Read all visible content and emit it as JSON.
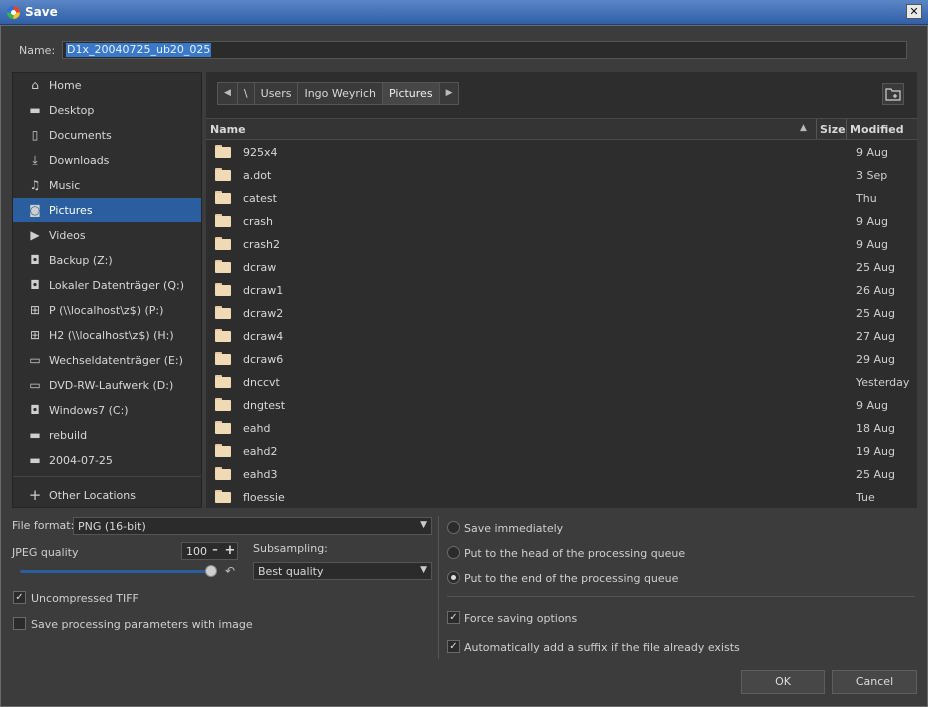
{
  "window": {
    "title": "Save",
    "close_glyph": "✕"
  },
  "name_field": {
    "label": "Name:",
    "value": "D1x_20040725_ub20_025"
  },
  "sidebar": {
    "items": [
      {
        "label": "Home",
        "icon": "home-icon",
        "glyph": "⌂",
        "active": false
      },
      {
        "label": "Desktop",
        "icon": "folder-icon",
        "glyph": "▬",
        "active": false
      },
      {
        "label": "Documents",
        "icon": "document-icon",
        "glyph": "▯",
        "active": false
      },
      {
        "label": "Downloads",
        "icon": "download-icon",
        "glyph": "⤓",
        "active": false
      },
      {
        "label": "Music",
        "icon": "music-icon",
        "glyph": "♫",
        "active": false
      },
      {
        "label": "Pictures",
        "icon": "camera-icon",
        "glyph": "◙",
        "active": true
      },
      {
        "label": "Videos",
        "icon": "video-icon",
        "glyph": "▶",
        "active": false
      },
      {
        "label": "Backup (Z:)",
        "icon": "drive-icon",
        "glyph": "◘",
        "active": false
      },
      {
        "label": "Lokaler Datenträger (Q:)",
        "icon": "drive-icon",
        "glyph": "◘",
        "active": false
      },
      {
        "label": "P (\\\\localhost\\z$) (P:)",
        "icon": "network-drive-icon",
        "glyph": "⊞",
        "active": false
      },
      {
        "label": "H2 (\\\\localhost\\z$) (H:)",
        "icon": "network-drive-icon",
        "glyph": "⊞",
        "active": false
      },
      {
        "label": "Wechseldatenträger (E:)",
        "icon": "removable-drive-icon",
        "glyph": "▭",
        "active": false
      },
      {
        "label": "DVD-RW-Laufwerk (D:)",
        "icon": "optical-drive-icon",
        "glyph": "▭",
        "active": false
      },
      {
        "label": "Windows7 (C:)",
        "icon": "drive-icon",
        "glyph": "◘",
        "active": false
      },
      {
        "label": "rebuild",
        "icon": "folder-icon",
        "glyph": "▬",
        "active": false
      },
      {
        "label": "2004-07-25",
        "icon": "folder-icon",
        "glyph": "▬",
        "active": false
      }
    ],
    "other_locations": {
      "label": "Other Locations",
      "glyph": "+"
    }
  },
  "pathbar": {
    "back_glyph": "◀",
    "forward_glyph": "▶",
    "segments": [
      "\\",
      "Users",
      "Ingo Weyrich",
      "Pictures"
    ]
  },
  "columns": {
    "name": "Name",
    "size": "Size",
    "modified": "Modified",
    "sort_glyph": "▲"
  },
  "files": [
    {
      "name": "925x4",
      "modified": "9 Aug"
    },
    {
      "name": "a.dot",
      "modified": "3 Sep"
    },
    {
      "name": "catest",
      "modified": "Thu"
    },
    {
      "name": "crash",
      "modified": "9 Aug"
    },
    {
      "name": "crash2",
      "modified": "9 Aug"
    },
    {
      "name": "dcraw",
      "modified": "25 Aug"
    },
    {
      "name": "dcraw1",
      "modified": "26 Aug"
    },
    {
      "name": "dcraw2",
      "modified": "25 Aug"
    },
    {
      "name": "dcraw4",
      "modified": "27 Aug"
    },
    {
      "name": "dcraw6",
      "modified": "29 Aug"
    },
    {
      "name": "dnccvt",
      "modified": "Yesterday"
    },
    {
      "name": "dngtest",
      "modified": "9 Aug"
    },
    {
      "name": "eahd",
      "modified": "18 Aug"
    },
    {
      "name": "eahd2",
      "modified": "19 Aug"
    },
    {
      "name": "eahd3",
      "modified": "25 Aug"
    },
    {
      "name": "floessie",
      "modified": "Tue"
    }
  ],
  "options": {
    "file_format_label": "File format:",
    "file_format_value": "PNG (16-bit)",
    "jpeg_quality_label": "JPEG quality",
    "jpeg_quality_value": "100",
    "subsampling_label": "Subsampling:",
    "subsampling_value": "Best quality",
    "uncompressed_tiff": {
      "label": "Uncompressed TIFF",
      "checked": true
    },
    "save_params": {
      "label": "Save processing parameters with image",
      "checked": false
    },
    "save_immediately": {
      "label": "Save immediately",
      "selected": false
    },
    "put_head": {
      "label": "Put to the head of the processing queue",
      "selected": false
    },
    "put_end": {
      "label": "Put to the end of the processing queue",
      "selected": true
    },
    "force_saving": {
      "label": "Force saving options",
      "checked": true
    },
    "auto_suffix": {
      "label": "Automatically add a suffix if the file already exists",
      "checked": true
    },
    "checkmark": "✓"
  },
  "buttons": {
    "ok": "OK",
    "cancel": "Cancel"
  },
  "colors": {
    "accent": "#2a5e9e",
    "selection": "#3a79c9",
    "background": "#3c3c3c"
  }
}
